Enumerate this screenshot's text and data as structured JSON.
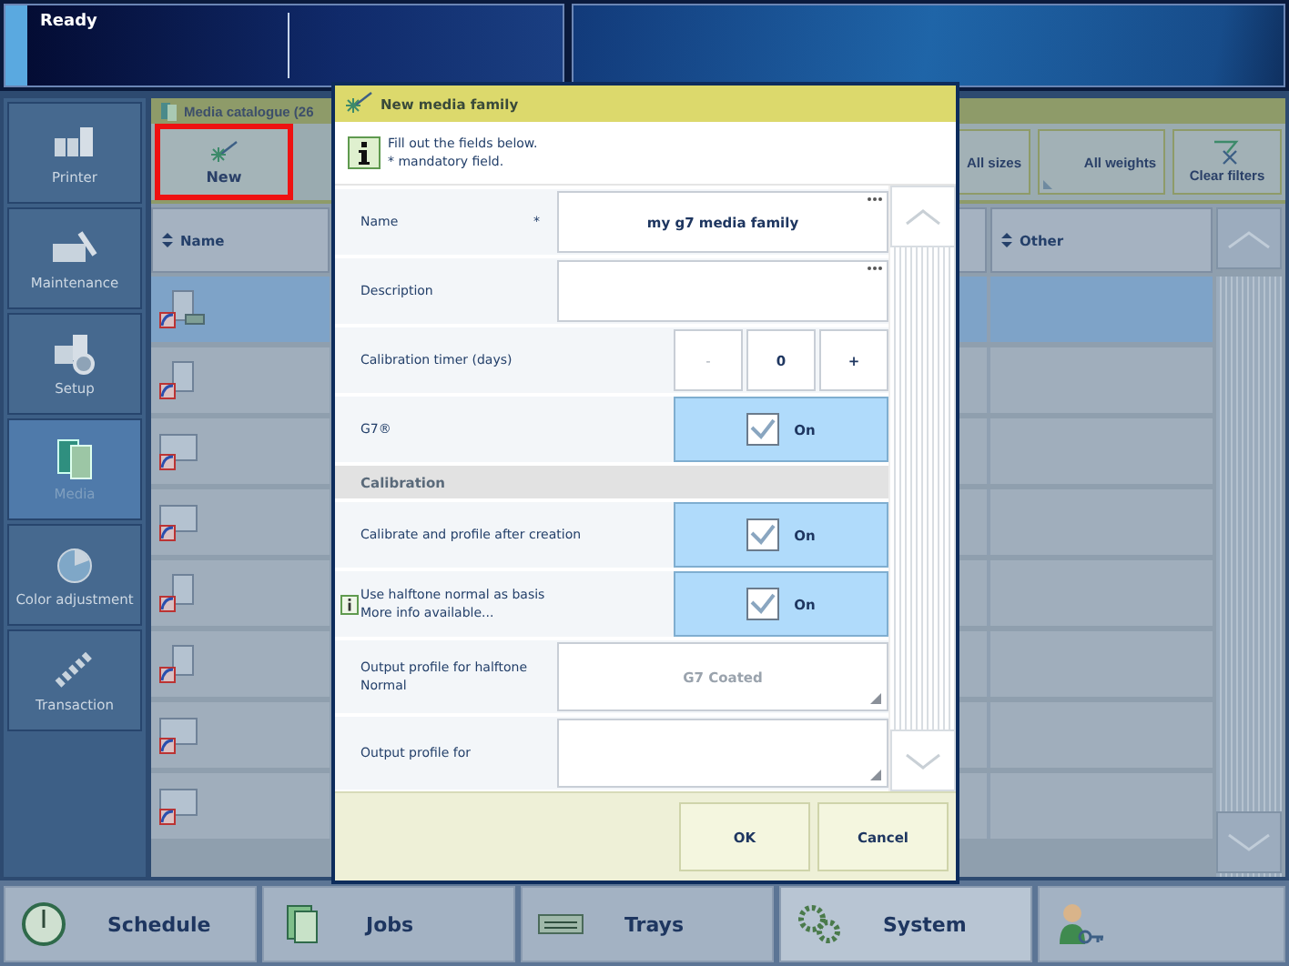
{
  "status_bar": {
    "text": "Ready"
  },
  "sidebar": {
    "items": [
      {
        "label": "Printer",
        "kind": "printer",
        "selected": false
      },
      {
        "label": "Maintenance",
        "kind": "maintenance",
        "selected": false
      },
      {
        "label": "Setup",
        "kind": "setup",
        "selected": false
      },
      {
        "label": "Media",
        "kind": "media",
        "selected": true
      },
      {
        "label": "Color adjustment",
        "kind": "color",
        "selected": false
      },
      {
        "label": "Transaction",
        "kind": "transaction",
        "selected": false
      }
    ]
  },
  "catalogue": {
    "title": "Media catalogue (26",
    "new_button": {
      "label": "New",
      "highlighted": true
    },
    "filters": [
      "All sizes",
      "All weights"
    ],
    "clear_filters": "Clear filters",
    "columns": [
      "Name",
      "Other"
    ],
    "rows": [
      {
        "kind": "portrait-tray",
        "selected": true
      },
      {
        "kind": "portrait",
        "selected": false
      },
      {
        "kind": "landscape",
        "selected": false
      },
      {
        "kind": "landscape",
        "selected": false
      },
      {
        "kind": "portrait",
        "selected": false
      },
      {
        "kind": "portrait",
        "selected": false
      },
      {
        "kind": "landscape",
        "selected": false
      },
      {
        "kind": "landscape",
        "selected": false
      }
    ]
  },
  "dialog": {
    "title": "New media family",
    "info_lines": [
      "Fill out the fields below.",
      "* mandatory field."
    ],
    "fields": [
      {
        "kind": "text",
        "label": "Name",
        "required_mark": "*",
        "value": "my g7 media family"
      },
      {
        "kind": "text",
        "label": "Description"
      },
      {
        "kind": "stepper",
        "label": "Calibration timer (days)",
        "minus": "-",
        "value": "0",
        "plus": "+"
      },
      {
        "kind": "toggle",
        "label": "G7®",
        "checked": true,
        "state_label": "On"
      },
      {
        "kind": "section",
        "label": "Calibration"
      },
      {
        "kind": "toggle",
        "label": "Calibrate and profile after creation",
        "checked": true,
        "state_label": "On"
      },
      {
        "kind": "toggle",
        "label": "Use halftone normal as basis",
        "note": "More info available...",
        "info": true,
        "checked": true,
        "state_label": "On"
      },
      {
        "kind": "select",
        "label": "Output profile for halftone Normal",
        "value": "G7 Coated"
      },
      {
        "kind": "select",
        "label": "Output profile for"
      }
    ],
    "buttons": [
      "OK",
      "Cancel"
    ]
  },
  "taskbar": [
    {
      "label": "Schedule",
      "kind": "schedule",
      "selected": false
    },
    {
      "label": "Jobs",
      "kind": "jobs",
      "selected": false
    },
    {
      "label": "Trays",
      "kind": "trays",
      "selected": false
    },
    {
      "label": "System",
      "kind": "system",
      "selected": true
    }
  ]
}
